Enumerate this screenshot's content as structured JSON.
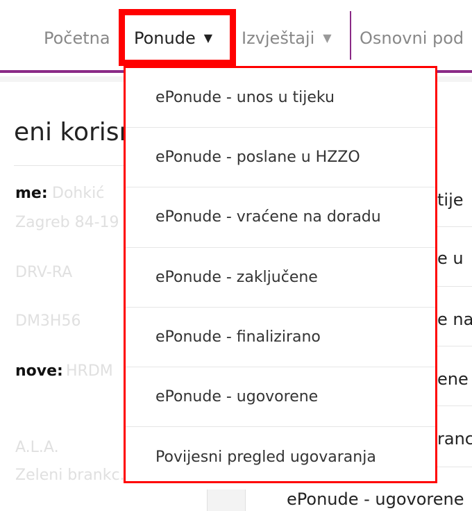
{
  "nav": {
    "home": "Početna",
    "offers": "Ponude",
    "reports": "Izvještaji",
    "basic": "Osnovni pod",
    "caret": "▼"
  },
  "background": {
    "title": "eni korisn",
    "label_name": "me:",
    "label_nove": "nove:",
    "faded_lines": [
      "Dohkić",
      "Zagreb 84-19",
      "DRV-RA",
      "DM3H56",
      "HRDM",
      "A.L.A.",
      "Zeleni brankc..."
    ],
    "right_snippets": [
      "tije",
      "e u",
      "e na",
      "ene",
      "ranc"
    ],
    "bottom_item": "ePonude - ugovorene"
  },
  "dropdown": {
    "items": [
      "ePonude - unos u tijeku",
      "ePonude - poslane u HZZO",
      "ePonude - vraćene na doradu",
      "ePonude - zaključene",
      "ePonude - finalizirano",
      "ePonude - ugovorene",
      "Povijesni pregled ugovaranja"
    ]
  }
}
